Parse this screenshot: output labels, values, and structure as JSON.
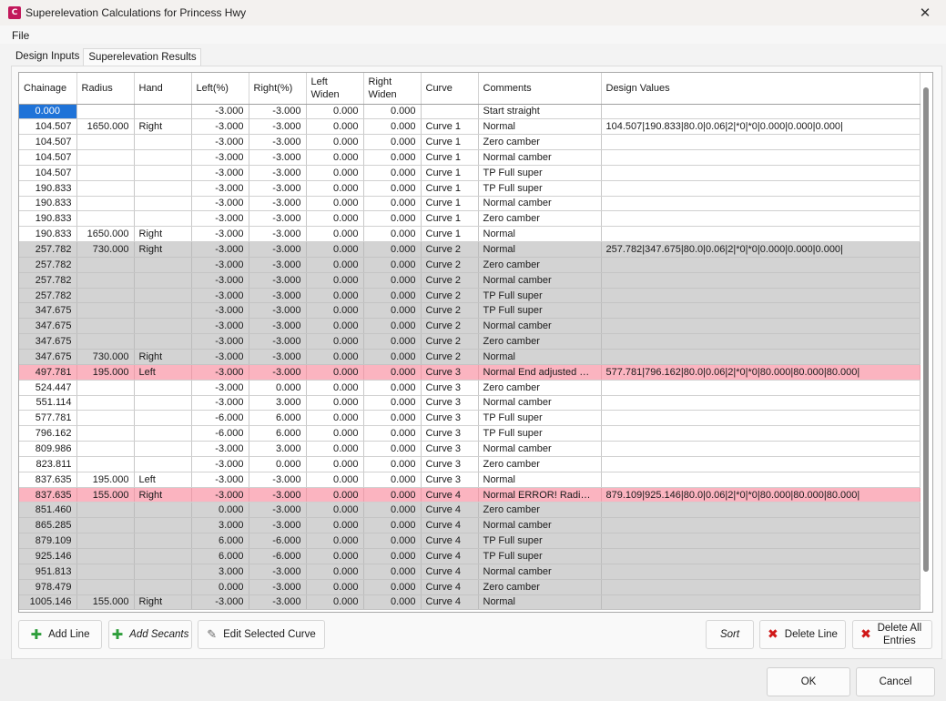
{
  "window": {
    "title": "Superelevation Calculations for Princess Hwy",
    "app_icon_letter": "C"
  },
  "menu": {
    "file": "File"
  },
  "tabs": [
    {
      "label": "Design Inputs"
    },
    {
      "label": "Superelevation Results"
    }
  ],
  "table": {
    "headers": [
      "Chainage",
      "Radius",
      "Hand",
      "Left(%)",
      "Right(%)",
      "Left Widen",
      "Right Widen",
      "Curve",
      "Comments",
      "Design Values"
    ],
    "rows": [
      [
        "0.000",
        "",
        "",
        "-3.000",
        "-3.000",
        "0.000",
        "0.000",
        "",
        "Start straight",
        ""
      ],
      [
        "104.507",
        "1650.000",
        "Right",
        "-3.000",
        "-3.000",
        "0.000",
        "0.000",
        "Curve 1",
        "Normal",
        "104.507|190.833|80.0|0.06|2|*0|*0|0.000|0.000|0.000|"
      ],
      [
        "104.507",
        "",
        "",
        "-3.000",
        "-3.000",
        "0.000",
        "0.000",
        "Curve 1",
        "Zero camber",
        ""
      ],
      [
        "104.507",
        "",
        "",
        "-3.000",
        "-3.000",
        "0.000",
        "0.000",
        "Curve 1",
        "Normal camber",
        ""
      ],
      [
        "104.507",
        "",
        "",
        "-3.000",
        "-3.000",
        "0.000",
        "0.000",
        "Curve 1",
        "TP Full super",
        ""
      ],
      [
        "190.833",
        "",
        "",
        "-3.000",
        "-3.000",
        "0.000",
        "0.000",
        "Curve 1",
        "TP Full super",
        ""
      ],
      [
        "190.833",
        "",
        "",
        "-3.000",
        "-3.000",
        "0.000",
        "0.000",
        "Curve 1",
        "Normal camber",
        ""
      ],
      [
        "190.833",
        "",
        "",
        "-3.000",
        "-3.000",
        "0.000",
        "0.000",
        "Curve 1",
        "Zero camber",
        ""
      ],
      [
        "190.833",
        "1650.000",
        "Right",
        "-3.000",
        "-3.000",
        "0.000",
        "0.000",
        "Curve 1",
        "Normal",
        ""
      ],
      [
        "257.782",
        "730.000",
        "Right",
        "-3.000",
        "-3.000",
        "0.000",
        "0.000",
        "Curve 2",
        "Normal",
        "257.782|347.675|80.0|0.06|2|*0|*0|0.000|0.000|0.000|"
      ],
      [
        "257.782",
        "",
        "",
        "-3.000",
        "-3.000",
        "0.000",
        "0.000",
        "Curve 2",
        "Zero camber",
        ""
      ],
      [
        "257.782",
        "",
        "",
        "-3.000",
        "-3.000",
        "0.000",
        "0.000",
        "Curve 2",
        "Normal camber",
        ""
      ],
      [
        "257.782",
        "",
        "",
        "-3.000",
        "-3.000",
        "0.000",
        "0.000",
        "Curve 2",
        "TP Full super",
        ""
      ],
      [
        "347.675",
        "",
        "",
        "-3.000",
        "-3.000",
        "0.000",
        "0.000",
        "Curve 2",
        "TP Full super",
        ""
      ],
      [
        "347.675",
        "",
        "",
        "-3.000",
        "-3.000",
        "0.000",
        "0.000",
        "Curve 2",
        "Normal camber",
        ""
      ],
      [
        "347.675",
        "",
        "",
        "-3.000",
        "-3.000",
        "0.000",
        "0.000",
        "Curve 2",
        "Zero camber",
        ""
      ],
      [
        "347.675",
        "730.000",
        "Right",
        "-3.000",
        "-3.000",
        "0.000",
        "0.000",
        "Curve 2",
        "Normal",
        ""
      ],
      [
        "497.781",
        "195.000",
        "Left",
        "-3.000",
        "-3.000",
        "0.000",
        "0.000",
        "Curve 3",
        "Normal End adjusted ER...",
        "577.781|796.162|80.0|0.06|2|*0|*0|80.000|80.000|80.000|"
      ],
      [
        "524.447",
        "",
        "",
        "-3.000",
        "0.000",
        "0.000",
        "0.000",
        "Curve 3",
        "Zero camber",
        ""
      ],
      [
        "551.114",
        "",
        "",
        "-3.000",
        "3.000",
        "0.000",
        "0.000",
        "Curve 3",
        "Normal camber",
        ""
      ],
      [
        "577.781",
        "",
        "",
        "-6.000",
        "6.000",
        "0.000",
        "0.000",
        "Curve 3",
        "TP Full super",
        ""
      ],
      [
        "796.162",
        "",
        "",
        "-6.000",
        "6.000",
        "0.000",
        "0.000",
        "Curve 3",
        "TP Full super",
        ""
      ],
      [
        "809.986",
        "",
        "",
        "-3.000",
        "3.000",
        "0.000",
        "0.000",
        "Curve 3",
        "Normal camber",
        ""
      ],
      [
        "823.811",
        "",
        "",
        "-3.000",
        "0.000",
        "0.000",
        "0.000",
        "Curve 3",
        "Zero camber",
        ""
      ],
      [
        "837.635",
        "195.000",
        "Left",
        "-3.000",
        "-3.000",
        "0.000",
        "0.000",
        "Curve 3",
        "Normal",
        ""
      ],
      [
        "837.635",
        "155.000",
        "Right",
        "-3.000",
        "-3.000",
        "0.000",
        "0.000",
        "Curve 4",
        "Normal ERROR! Radius t...",
        "879.109|925.146|80.0|0.06|2|*0|*0|80.000|80.000|80.000|"
      ],
      [
        "851.460",
        "",
        "",
        "0.000",
        "-3.000",
        "0.000",
        "0.000",
        "Curve 4",
        "Zero camber",
        ""
      ],
      [
        "865.285",
        "",
        "",
        "3.000",
        "-3.000",
        "0.000",
        "0.000",
        "Curve 4",
        "Normal camber",
        ""
      ],
      [
        "879.109",
        "",
        "",
        "6.000",
        "-6.000",
        "0.000",
        "0.000",
        "Curve 4",
        "TP Full super",
        ""
      ],
      [
        "925.146",
        "",
        "",
        "6.000",
        "-6.000",
        "0.000",
        "0.000",
        "Curve 4",
        "TP Full super",
        ""
      ],
      [
        "951.813",
        "",
        "",
        "3.000",
        "-3.000",
        "0.000",
        "0.000",
        "Curve 4",
        "Normal camber",
        ""
      ],
      [
        "978.479",
        "",
        "",
        "0.000",
        "-3.000",
        "0.000",
        "0.000",
        "Curve 4",
        "Zero camber",
        ""
      ],
      [
        "1005.146",
        "155.000",
        "Right",
        "-3.000",
        "-3.000",
        "0.000",
        "0.000",
        "Curve 4",
        "Normal",
        ""
      ]
    ],
    "row_styles": [
      "sel",
      "",
      "",
      "",
      "",
      "",
      "",
      "",
      "",
      "grey",
      "grey",
      "grey",
      "grey",
      "grey",
      "grey",
      "grey",
      "grey",
      "pink",
      "",
      "",
      "",
      "",
      "",
      "",
      "",
      "pink",
      "grey",
      "grey",
      "grey",
      "grey",
      "grey",
      "grey",
      "grey"
    ]
  },
  "buttons": {
    "add_line": "Add Line",
    "add_secants": "Add Secants",
    "edit_selected_curve": "Edit Selected Curve",
    "sort": "Sort",
    "delete_line": "Delete Line",
    "delete_all_entries": "Delete All Entries",
    "ok": "OK",
    "cancel": "Cancel"
  },
  "colors": {
    "selection": "#1f73d8",
    "curve_group_grey": "#d3d3d3",
    "error_pink": "#fbb4c0"
  }
}
